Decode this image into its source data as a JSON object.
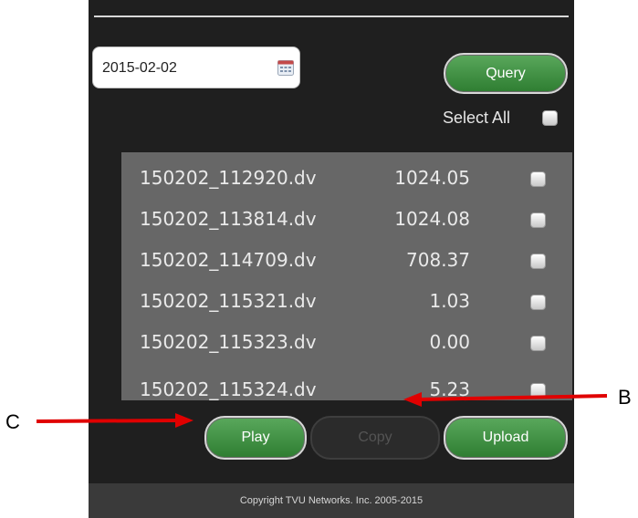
{
  "date_field": {
    "value": "2015-02-02"
  },
  "buttons": {
    "query": "Query",
    "play": "Play",
    "copy": "Copy",
    "upload": "Upload"
  },
  "select_all": {
    "label": "Select All"
  },
  "files": [
    {
      "name": "150202_112920.dv",
      "size": "1024.05"
    },
    {
      "name": "150202_113814.dv",
      "size": "1024.08"
    },
    {
      "name": "150202_114709.dv",
      "size": "708.37"
    },
    {
      "name": "150202_115321.dv",
      "size": "1.03"
    },
    {
      "name": "150202_115323.dv",
      "size": "0.00"
    },
    {
      "name": "150202_115324.dv",
      "size": "5.23"
    }
  ],
  "footer": {
    "text": "Copyright TVU Networks. Inc. 2005-2015"
  },
  "annotations": {
    "left_label": "C",
    "right_label": "B"
  },
  "colors": {
    "arrow": "#e00000",
    "button_green": "#3e8f41"
  }
}
